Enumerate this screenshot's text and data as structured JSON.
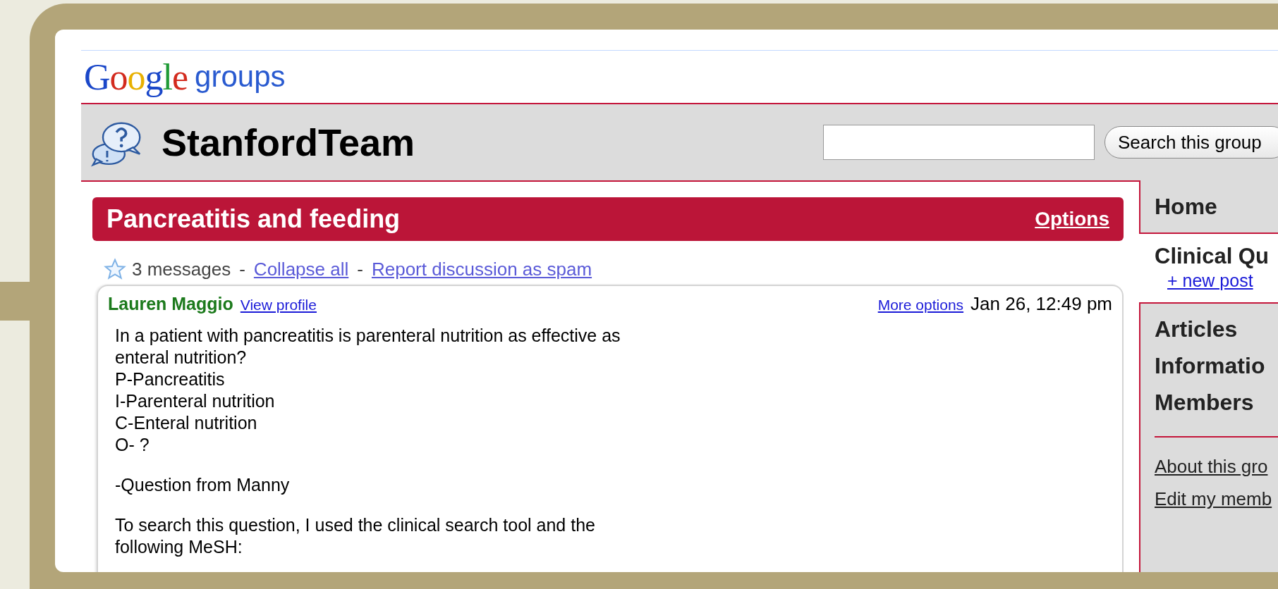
{
  "logo": {
    "brand": "Google",
    "product": "groups"
  },
  "group": {
    "name": "StanfordTeam",
    "search": {
      "button": "Search this group"
    }
  },
  "discussion": {
    "title": "Pancreatitis and feeding",
    "options": "Options",
    "starred": false,
    "count": "3 messages",
    "separators": [
      "-",
      "-"
    ],
    "collapse": "Collapse all",
    "report": "Report discussion as spam"
  },
  "message": {
    "author": "Lauren Maggio",
    "profile": "View profile",
    "more": "More options",
    "date": "Jan 26, 12:49 pm",
    "paragraphs": [
      [
        "In a patient with pancreatitis is parenteral nutrition as effective as",
        "enteral nutrition?",
        "P-Pancreatitis",
        "I-Parenteral nutrition",
        "C-Enteral nutrition",
        "O- ?"
      ],
      [
        "-Question from Manny"
      ],
      [
        "To search this question, I used the clinical search tool and the",
        "following MeSH:"
      ]
    ]
  },
  "sidebar": {
    "home": "Home",
    "section": "Clinical Qu",
    "new_post": "+ new post",
    "items": [
      {
        "label": "Articles"
      },
      {
        "label": "Informatio"
      },
      {
        "label": "Members"
      }
    ],
    "links": [
      {
        "label": "About this gro"
      },
      {
        "label": "Edit my memb"
      }
    ]
  }
}
